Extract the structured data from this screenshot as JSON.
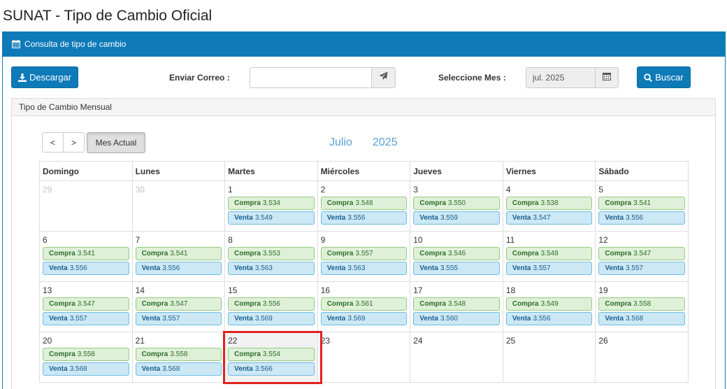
{
  "page": {
    "title": "SUNAT - Tipo de Cambio Oficial"
  },
  "panel": {
    "heading": "Consulta de tipo de cambio"
  },
  "toolbar": {
    "download_label": "Descargar",
    "email_label": "Enviar Correo :",
    "email_value": "",
    "month_label": "Seleccione Mes :",
    "month_value": "jul. 2025",
    "search_label": "Buscar"
  },
  "calendar": {
    "panel_title": "Tipo de Cambio Mensual",
    "prev_label": "<",
    "next_label": ">",
    "today_label": "Mes Actual",
    "month_name": "Julio",
    "year": "2025",
    "weekdays": [
      "Domingo",
      "Lunes",
      "Martes",
      "Miércoles",
      "Jueves",
      "Viernes",
      "Sábado"
    ],
    "buy_label": "Compra",
    "sell_label": "Venta",
    "weeks": [
      [
        {
          "day": "29",
          "muted": true
        },
        {
          "day": "30",
          "muted": true
        },
        {
          "day": "1",
          "buy": "3.534",
          "sell": "3.549"
        },
        {
          "day": "2",
          "buy": "3.548",
          "sell": "3.556"
        },
        {
          "day": "3",
          "buy": "3.550",
          "sell": "3.559"
        },
        {
          "day": "4",
          "buy": "3.538",
          "sell": "3.547"
        },
        {
          "day": "5",
          "buy": "3.541",
          "sell": "3.556"
        }
      ],
      [
        {
          "day": "6",
          "buy": "3.541",
          "sell": "3.556"
        },
        {
          "day": "7",
          "buy": "3.541",
          "sell": "3.556"
        },
        {
          "day": "8",
          "buy": "3.553",
          "sell": "3.563"
        },
        {
          "day": "9",
          "buy": "3.557",
          "sell": "3.563"
        },
        {
          "day": "10",
          "buy": "3.546",
          "sell": "3.555"
        },
        {
          "day": "11",
          "buy": "3.548",
          "sell": "3.557"
        },
        {
          "day": "12",
          "buy": "3.547",
          "sell": "3.557"
        }
      ],
      [
        {
          "day": "13",
          "buy": "3.547",
          "sell": "3.557"
        },
        {
          "day": "14",
          "buy": "3.547",
          "sell": "3.557"
        },
        {
          "day": "15",
          "buy": "3.556",
          "sell": "3.569"
        },
        {
          "day": "16",
          "buy": "3.561",
          "sell": "3.569"
        },
        {
          "day": "17",
          "buy": "3.548",
          "sell": "3.560"
        },
        {
          "day": "18",
          "buy": "3.549",
          "sell": "3.556"
        },
        {
          "day": "19",
          "buy": "3.558",
          "sell": "3.568"
        }
      ],
      [
        {
          "day": "20",
          "buy": "3.558",
          "sell": "3.568"
        },
        {
          "day": "21",
          "buy": "3.558",
          "sell": "3.568"
        },
        {
          "day": "22",
          "buy": "3.554",
          "sell": "3.566",
          "today": true
        },
        {
          "day": "23"
        },
        {
          "day": "24"
        },
        {
          "day": "25"
        },
        {
          "day": "26"
        }
      ]
    ]
  },
  "icons": {
    "heading_icon": "calendar-icon",
    "download_icon": "download-icon",
    "send_icon": "paper-plane-icon",
    "month_icon": "calendar-icon",
    "search_icon": "search-icon"
  },
  "colors": {
    "primary": "#0e7ab8",
    "buy_bg": "#dff0d8",
    "sell_bg": "#cce8f5",
    "highlight": "#e0221f"
  }
}
